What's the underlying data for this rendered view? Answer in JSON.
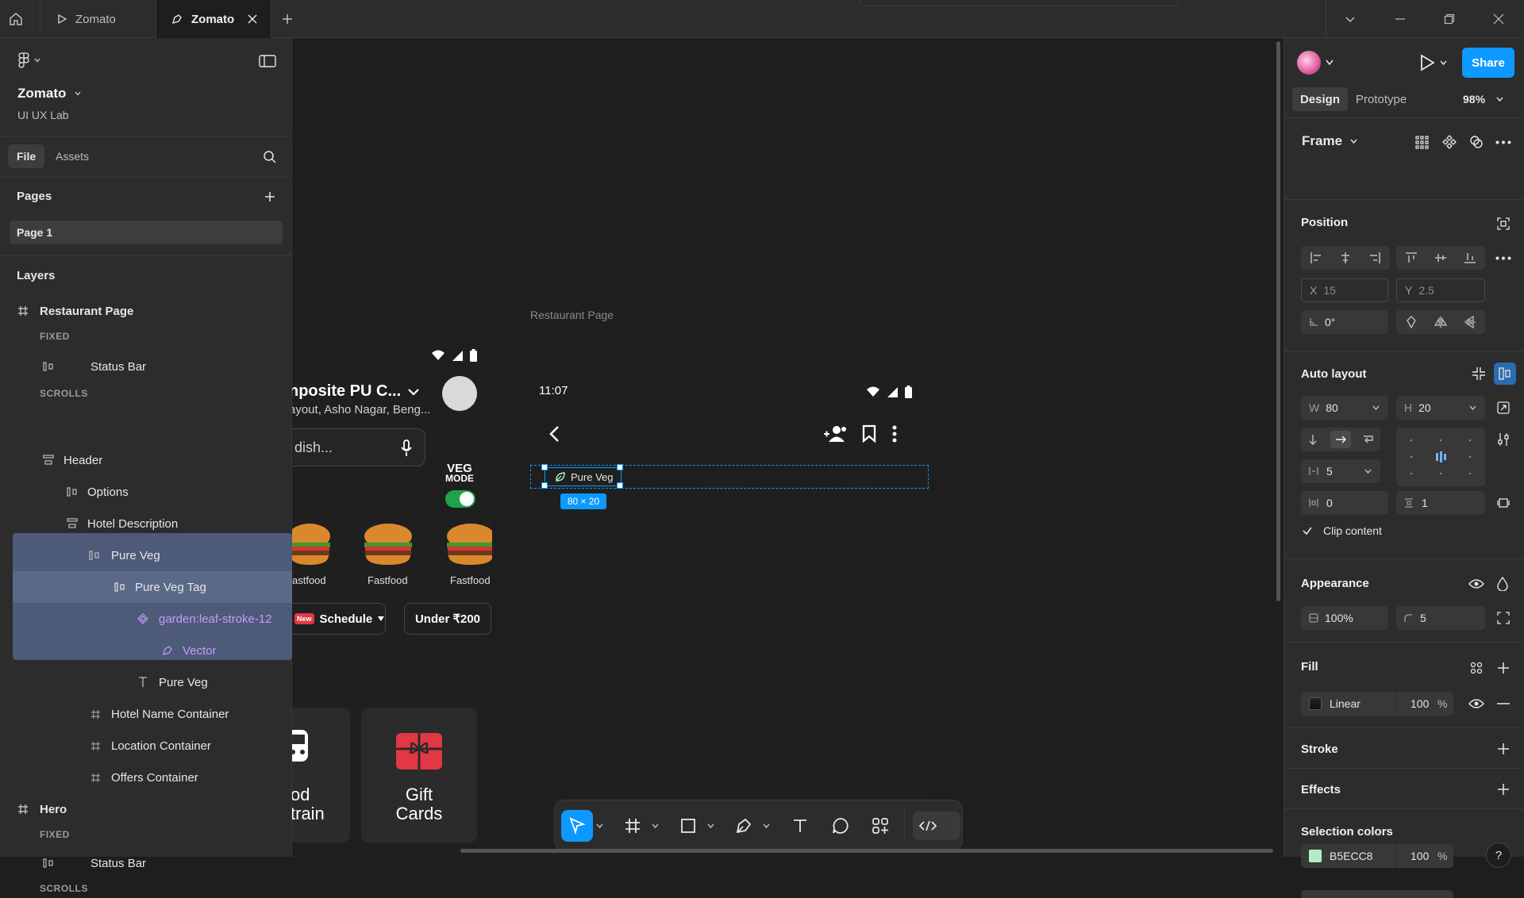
{
  "tabs": [
    {
      "label": "Zomato",
      "active": false
    },
    {
      "label": "Zomato",
      "active": true
    }
  ],
  "file": {
    "name": "Zomato",
    "team": "UI UX Lab"
  },
  "left_tabs": {
    "file": "File",
    "assets": "Assets"
  },
  "pages": {
    "title": "Pages",
    "items": [
      "Page 1"
    ]
  },
  "layers": {
    "title": "Layers",
    "items": [
      {
        "label": "Restaurant Page",
        "icon": "frame-icon",
        "bold": true
      },
      {
        "label": "FIXED",
        "section": true
      },
      {
        "label": "Status Bar",
        "icon": "autolayout-h-icon"
      },
      {
        "label": "SCROLLS",
        "section": true
      },
      {
        "label": "Header",
        "icon": "autolayout-v-icon"
      },
      {
        "label": "Options",
        "icon": "autolayout-h-icon"
      },
      {
        "label": "Hotel Description",
        "icon": "autolayout-v-icon"
      },
      {
        "label": "Pure Veg",
        "icon": "autolayout-h-icon"
      },
      {
        "label": "Pure Veg Tag",
        "icon": "autolayout-h-icon",
        "selected": true
      },
      {
        "label": "garden:leaf-stroke-12",
        "icon": "component-icon",
        "selected": true
      },
      {
        "label": "Vector",
        "icon": "vector-icon",
        "selected": true
      },
      {
        "label": "Pure Veg",
        "icon": "text-icon",
        "selected": true
      },
      {
        "label": "Hotel Name Container",
        "icon": "frame-icon"
      },
      {
        "label": "Location Container",
        "icon": "frame-icon"
      },
      {
        "label": "Offers Container",
        "icon": "frame-icon"
      },
      {
        "label": "Hero",
        "icon": "frame-icon",
        "bold": true
      },
      {
        "label": "FIXED",
        "section": true
      },
      {
        "label": "Status Bar",
        "icon": "autolayout-h-icon"
      },
      {
        "label": "SCROLLS",
        "section": true
      }
    ]
  },
  "canvas": {
    "frame_label": "Restaurant Page",
    "time": "11:07",
    "tag_label": "Pure Veg",
    "size_badge": "80 × 20",
    "left_frame": {
      "location_title": "nposite PU C...",
      "location_sub": "ayout, Asho Nagar, Beng...",
      "search_placeholder": "dish...",
      "veg_mode": [
        "VEG",
        "MODE"
      ],
      "food_labels": [
        "astfood",
        "Fastfood",
        "Fastfood"
      ],
      "new_badge": "New",
      "chips": [
        "Schedule",
        "Under ₹200"
      ],
      "card_partial": [
        "od",
        "train"
      ],
      "card_gift": [
        "Gift",
        "Cards"
      ]
    }
  },
  "right": {
    "tabs": {
      "design": "Design",
      "prototype": "Prototype"
    },
    "zoom": "98%",
    "share": "Share",
    "frame_label": "Frame",
    "position": {
      "title": "Position",
      "x": "15",
      "y": "2.5",
      "rotation": "0°"
    },
    "auto_layout": {
      "title": "Auto layout",
      "w": "80",
      "h": "20",
      "gap": "5",
      "padding_h": "0",
      "padding_v": "1",
      "clip": "Clip content"
    },
    "appearance": {
      "title": "Appearance",
      "opacity": "100%",
      "radius": "5"
    },
    "fill": {
      "title": "Fill",
      "type": "Linear",
      "opacity": "100",
      "unit": "%"
    },
    "stroke": {
      "title": "Stroke"
    },
    "effects": {
      "title": "Effects"
    },
    "selection_colors": {
      "title": "Selection colors",
      "hex": "B5ECC8",
      "opacity": "100",
      "unit": "%",
      "swatch": "#B5ECC8"
    }
  },
  "colors": {
    "accent": "#0d99ff",
    "selection": "#4d5a78",
    "component": "#c79bff",
    "veg_green": "#1fa34a",
    "brand_red": "#e23744"
  }
}
